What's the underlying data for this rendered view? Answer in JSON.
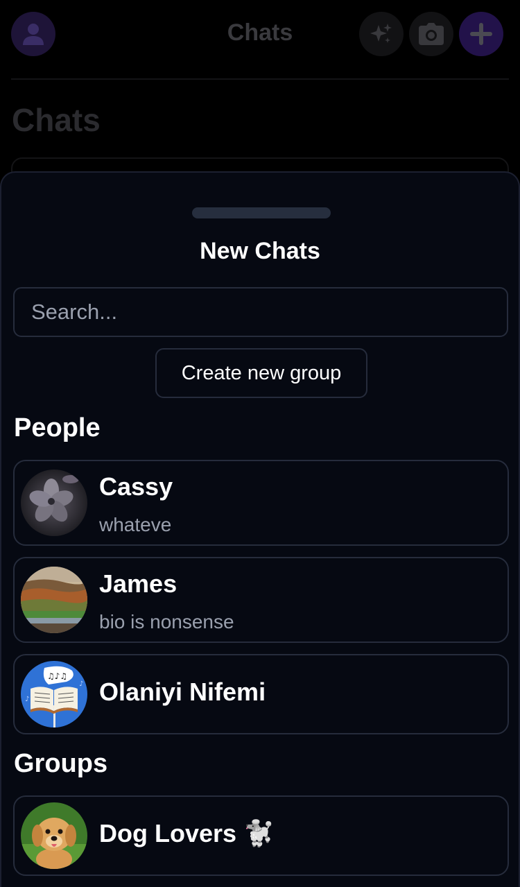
{
  "background": {
    "header_title": "Chats",
    "page_heading": "Chats",
    "icons": [
      "user-avatar-icon",
      "sparkle-icon",
      "camera-icon",
      "plus-icon"
    ]
  },
  "sheet": {
    "title": "New Chats",
    "search": {
      "placeholder": "Search...",
      "value": ""
    },
    "create_group_label": "Create new group",
    "people_heading": "People",
    "groups_heading": "Groups",
    "people": [
      {
        "name": "Cassy",
        "bio": "whateve",
        "avatar": "flower-photo"
      },
      {
        "name": "James",
        "bio": "bio is nonsense",
        "avatar": "landscape-photo"
      },
      {
        "name": "Olaniyi Nifemi",
        "bio": "",
        "avatar": "music-book-illustration"
      }
    ],
    "groups": [
      {
        "name": "Dog Lovers 🐩",
        "avatar": "puppy-photo"
      }
    ]
  },
  "colors": {
    "sheet_bg": "#060912",
    "border": "#262c3c",
    "accent_purple": "#22124a",
    "muted_text": "#9aa0ae"
  }
}
